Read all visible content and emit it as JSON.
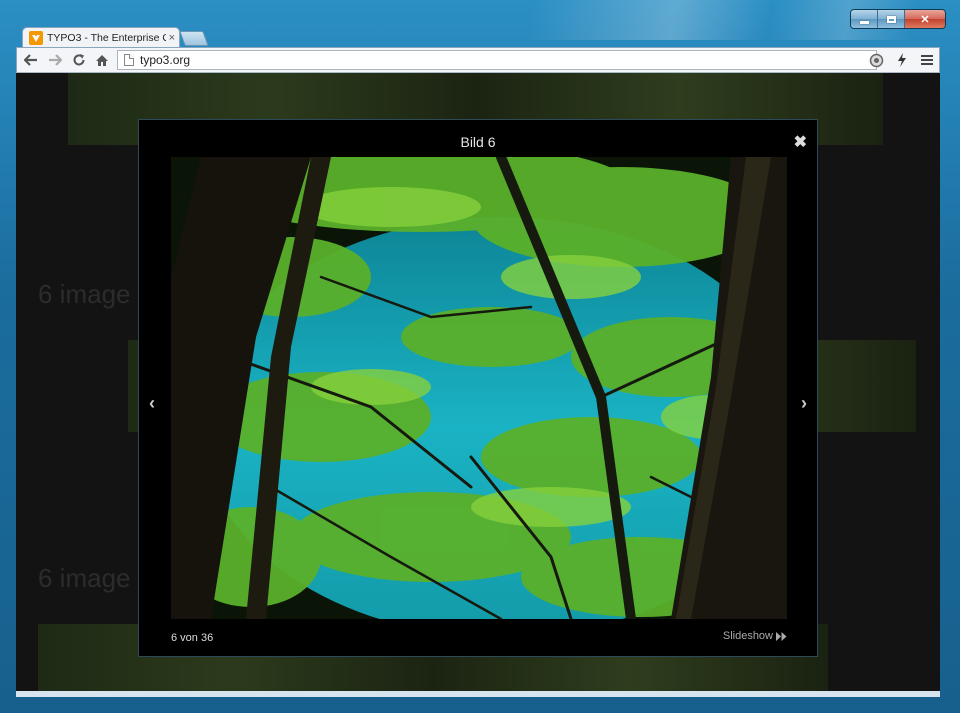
{
  "window": {
    "controls": [
      "minimize",
      "maximize",
      "close"
    ]
  },
  "tab": {
    "title": "TYPO3 - The Enterprise O",
    "close": "×",
    "favicon": "typo3-logo-icon"
  },
  "toolbar": {
    "url": "typo3.org",
    "icons": [
      "back-icon",
      "forward-icon",
      "reload-icon",
      "home-icon",
      "page-icon",
      "extension-icon",
      "lightning-icon",
      "menu-icon"
    ]
  },
  "page": {
    "headings": [
      "6 image",
      "6 image"
    ]
  },
  "lightbox": {
    "title": "Bild 6",
    "close": "✖",
    "prev": "‹",
    "next": "›",
    "counter": "6 von 36",
    "slideshow": "Slideshow"
  },
  "colors": {
    "water": "#1aa4b4",
    "foliage": "#5aa82a",
    "trunk": "#1a1a12",
    "backdrop": "#131313"
  }
}
